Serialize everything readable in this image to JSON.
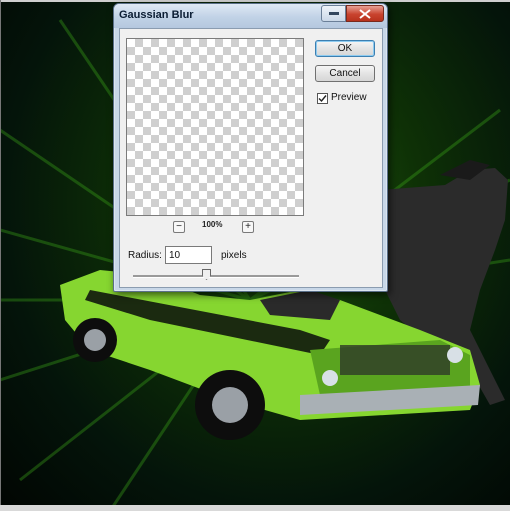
{
  "dialog": {
    "title": "Gaussian Blur",
    "ok_label": "OK",
    "cancel_label": "Cancel",
    "preview_label": "Preview",
    "preview_checked": true,
    "zoom_out": "−",
    "zoom_in": "+",
    "zoom_level": "100%",
    "radius_label": "Radius:",
    "radius_value": "10",
    "pixels_label": "pixels",
    "slider_fraction": 0.44
  },
  "colors": {
    "titlebar": "#c8d7e8",
    "close_button": "#c9432e",
    "car_body": "#8fe53a",
    "background_glow": "#1f5a10"
  },
  "icons": {
    "minimize": "minimize-icon",
    "maximize": "maximize-icon",
    "close": "close-icon",
    "checkbox": "checkmark-icon"
  }
}
